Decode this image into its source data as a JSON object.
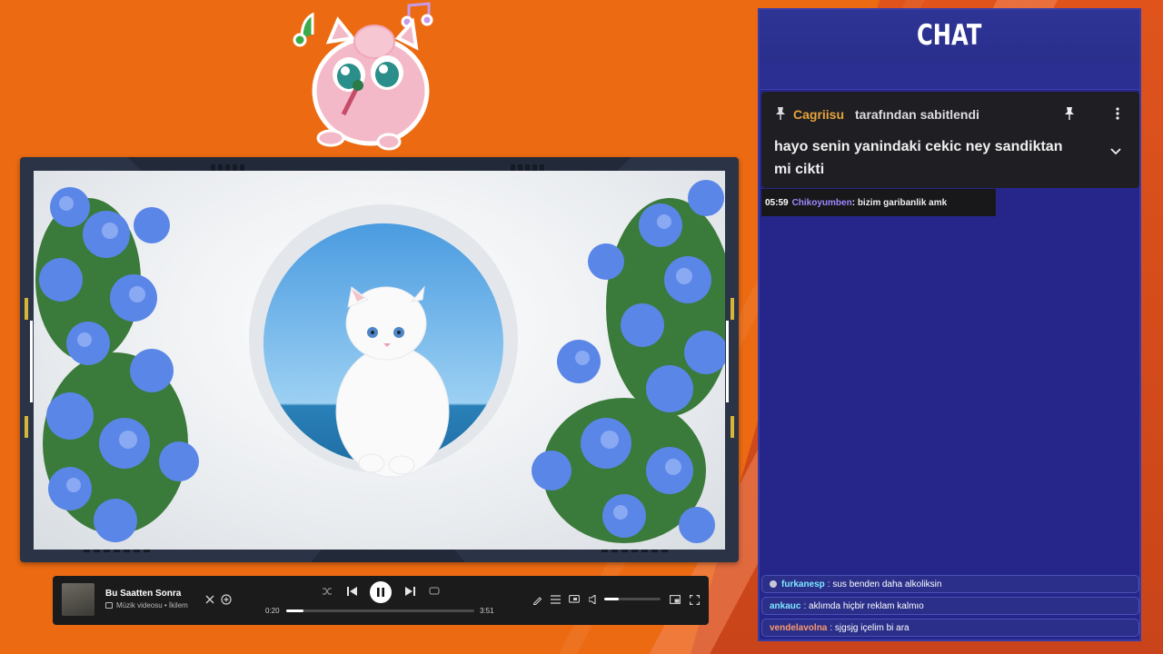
{
  "colors": {
    "background": "#ec6a12",
    "chat_panel": "#26268a",
    "pinned_user": "#e8a33b",
    "dark_msg_user": "#9f88ff"
  },
  "mascot": {
    "icon": "singing-pink-mascot-icon"
  },
  "video": {
    "content": "white cat in round wall window with blue flowers",
    "icon": "video-image"
  },
  "player": {
    "song_title": "Bu Saatten Sonra",
    "song_subtitle": "Müzik videosu • İkilem",
    "time_current": "0:20",
    "time_total": "3:51",
    "progress_fraction": 0.09,
    "volume_fraction": 0.25,
    "icons": [
      "close-icon",
      "add-icon",
      "shuffle-icon",
      "previous-icon",
      "pause-icon",
      "next-icon",
      "repeat-icon",
      "edit-icon",
      "queue-icon",
      "cast-icon",
      "volume-icon",
      "miniplayer-icon",
      "fullscreen-icon"
    ]
  },
  "chat": {
    "title": "CHAT",
    "pinned": {
      "user": "Cagriisu",
      "by_text": "tarafından sabitlendi",
      "message": "hayo senin yanindaki cekic ney sandiktan mi cikti"
    },
    "dark_message": {
      "time": "05:59",
      "user": "Chikoyumben",
      "text": "bizim garibanlik amk"
    },
    "messages": [
      {
        "user": "furkanesp",
        "user_color": "#7fe8ff",
        "text": "sus benden daha alkoliksin",
        "badge": true
      },
      {
        "user": "ankauc",
        "user_color": "#7fe8ff",
        "text": "aklımda hiçbir reklam kalmıo",
        "badge": false
      },
      {
        "user": "vendelavolna",
        "user_color": "#ff9a6a",
        "text": "sjgsjg içelim bi ara",
        "badge": false
      }
    ]
  }
}
